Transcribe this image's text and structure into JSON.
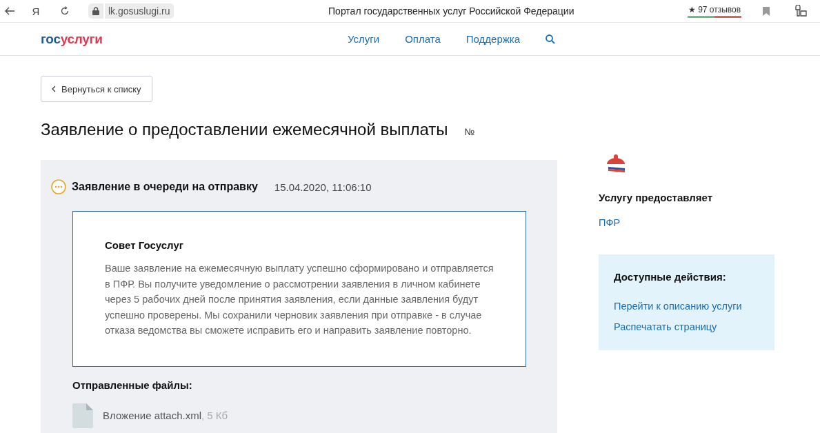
{
  "browser": {
    "yandex_glyph": "Я",
    "url": "lk.gosuslugi.ru",
    "title": "Портал государственных услуг Российской Федерации",
    "rating": "★",
    "reviews": "97 отзывов"
  },
  "header": {
    "logo_part1": "гос",
    "logo_part2": "услуги",
    "nav": [
      "Услуги",
      "Оплата",
      "Поддержка"
    ]
  },
  "back_button": "Вернуться к списку",
  "page_title": "Заявление о предоставлении ежемесячной выплаты",
  "number_label": "№",
  "status": {
    "text": "Заявление в очереди на отправку",
    "datetime": "15.04.2020, 11:06:10"
  },
  "advice": {
    "title": "Совет Госуслуг",
    "body": "Ваше заявление на ежемесячную выплату успешно сформировано и отправляется в ПФР. Вы получите уведомление о рассмотрении заявления в личном кабинете через 5 рабочих дней после принятия заявления, если данные заявления будут успешно проверены. Мы сохранили черновик заявления при отправке - в случае отказа ведомства вы сможете исправить его и направить заявление повторно."
  },
  "files": {
    "title": "Отправленные файлы:",
    "items": [
      {
        "name": "Вложение attach.xml",
        "size": ", 5 Кб"
      }
    ]
  },
  "provider": {
    "title": "Услугу предоставляет",
    "name": "ПФР"
  },
  "actions": {
    "title": "Доступные действия:",
    "links": [
      "Перейти к описанию услуги",
      "Распечатать страницу"
    ]
  }
}
